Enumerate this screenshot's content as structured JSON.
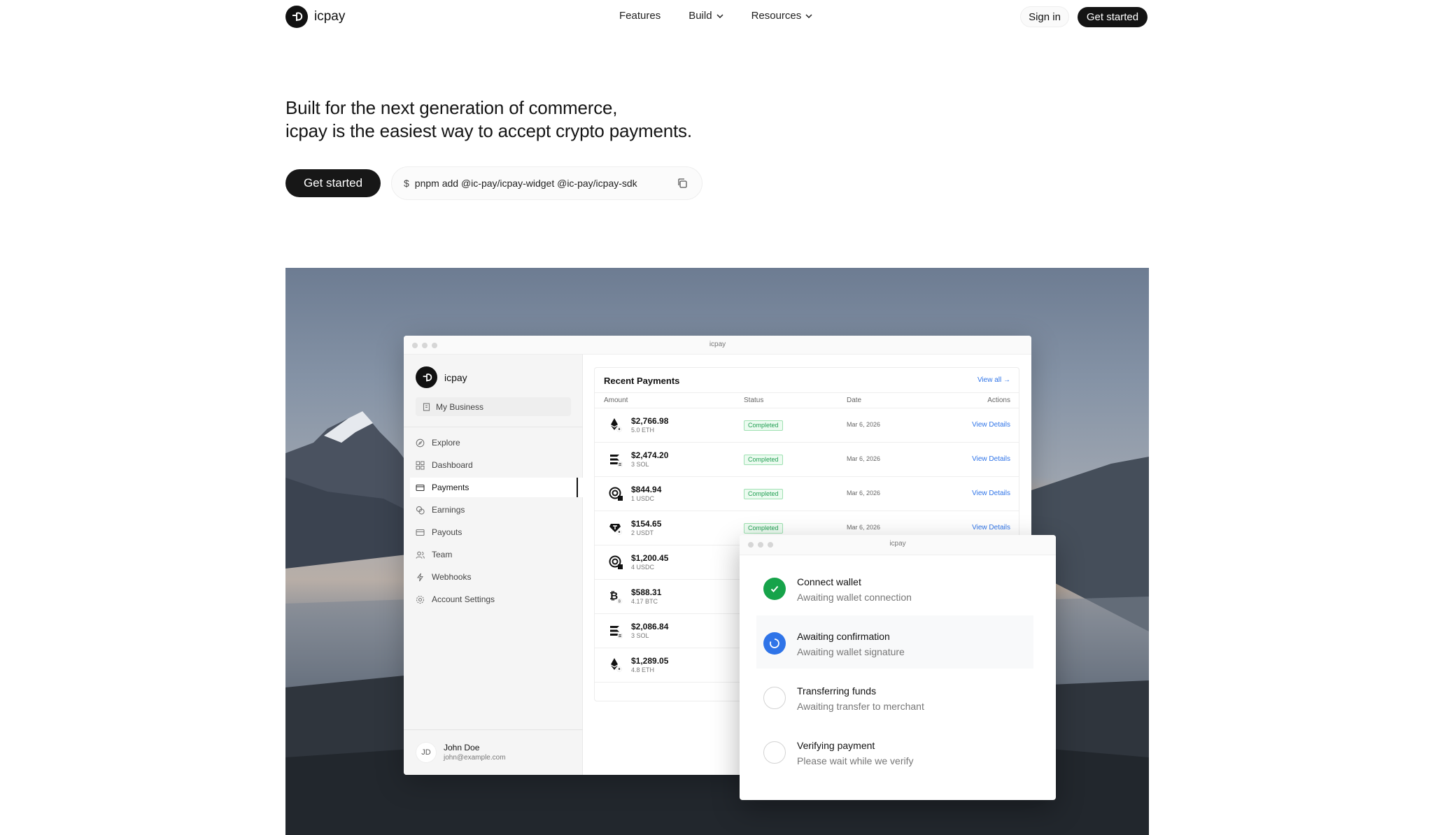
{
  "nav": {
    "brand": "icpay",
    "links": [
      {
        "label": "Features"
      },
      {
        "label": "Build"
      },
      {
        "label": "Resources"
      }
    ],
    "sign_in": "Sign in",
    "get_started": "Get started"
  },
  "hero": {
    "line1": "Built for the next generation of commerce,",
    "line2": "icpay is the easiest way to accept crypto payments.",
    "cta": "Get started",
    "command_prefix": "$",
    "command": "pnpm add @ic-pay/icpay-widget @ic-pay/icpay-sdk"
  },
  "dashboard": {
    "window_title": "icpay",
    "brand": "icpay",
    "business": "My Business",
    "menu": [
      {
        "label": "Explore",
        "icon": "compass-icon"
      },
      {
        "label": "Dashboard",
        "icon": "grid-icon"
      },
      {
        "label": "Payments",
        "icon": "card-icon"
      },
      {
        "label": "Earnings",
        "icon": "coins-icon"
      },
      {
        "label": "Payouts",
        "icon": "wallet-icon"
      },
      {
        "label": "Team",
        "icon": "users-icon"
      },
      {
        "label": "Webhooks",
        "icon": "webhook-icon"
      },
      {
        "label": "Account Settings",
        "icon": "gear-icon"
      }
    ],
    "active_menu": "Payments",
    "user": {
      "initials": "JD",
      "name": "John Doe",
      "email": "john@example.com"
    },
    "recent": {
      "title": "Recent Payments",
      "view_all": "View all →",
      "columns": {
        "amount": "Amount",
        "status": "Status",
        "date": "Date",
        "actions": "Actions"
      },
      "rows": [
        {
          "amount": "$2,766.98",
          "sub": "5.0 ETH",
          "coin": "eth",
          "status": "Completed",
          "date": "Mar 6, 2026",
          "action": "View Details"
        },
        {
          "amount": "$2,474.20",
          "sub": "3 SOL",
          "coin": "sol",
          "status": "Completed",
          "date": "Mar 6, 2026",
          "action": "View Details"
        },
        {
          "amount": "$844.94",
          "sub": "1 USDC",
          "coin": "usdc",
          "status": "Completed",
          "date": "Mar 6, 2026",
          "action": "View Details"
        },
        {
          "amount": "$154.65",
          "sub": "2 USDT",
          "coin": "usdt",
          "status": "Completed",
          "date": "Mar 6, 2026",
          "action": "View Details"
        },
        {
          "amount": "$1,200.45",
          "sub": "4 USDC",
          "coin": "usdc",
          "status": "",
          "date": "",
          "action": ""
        },
        {
          "amount": "$588.31",
          "sub": "4.17 BTC",
          "coin": "btc",
          "status": "",
          "date": "",
          "action": ""
        },
        {
          "amount": "$2,086.84",
          "sub": "3 SOL",
          "coin": "sol",
          "status": "",
          "date": "",
          "action": ""
        },
        {
          "amount": "$1,289.05",
          "sub": "4.8 ETH",
          "coin": "eth",
          "status": "",
          "date": "",
          "action": ""
        }
      ]
    }
  },
  "progress": {
    "window_title": "icpay",
    "steps": [
      {
        "title": "Connect wallet",
        "sub": "Awaiting wallet connection",
        "state": "done"
      },
      {
        "title": "Awaiting confirmation",
        "sub": "Awaiting wallet signature",
        "state": "current"
      },
      {
        "title": "Transferring funds",
        "sub": "Awaiting transfer to merchant",
        "state": "todo"
      },
      {
        "title": "Verifying payment",
        "sub": "Please wait while we verify",
        "state": "todo"
      }
    ]
  },
  "colors": {
    "accent": "#2f74e8",
    "success": "#16a34a",
    "dark": "#141414"
  }
}
